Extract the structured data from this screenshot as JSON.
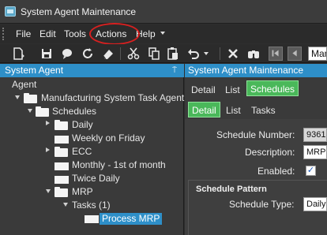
{
  "window": {
    "title": "System Agent Maintenance"
  },
  "menu": {
    "items": [
      "File",
      "Edit",
      "Tools",
      "Actions",
      "Help"
    ]
  },
  "toolbar": {
    "icons": [
      "new-icon",
      "save-icon",
      "chat-icon",
      "refresh-icon",
      "eraser-icon",
      "cut-icon",
      "copy-icon",
      "paste-icon",
      "undo-icon",
      "delete-icon",
      "binoculars-icon",
      "first-record-icon",
      "previous-record-icon"
    ],
    "search_value": "Manu"
  },
  "left_panel": {
    "header": "System Agent",
    "pin_glyph": "⍑",
    "tree": {
      "root": "Agent",
      "agent": "Manufacturing System Task Agent",
      "schedules": "Schedules",
      "items": [
        "Daily",
        "Weekly on Friday",
        "ECC",
        "Monthly - 1st of month",
        "Twice Daily",
        "MRP"
      ],
      "tasks": "Tasks (1)",
      "selected_task": "Process MRP"
    }
  },
  "right_panel": {
    "header": "System Agent Maintenance",
    "tabs_top": [
      "Detail",
      "List",
      "Schedules"
    ],
    "tabs_sub": [
      "Detail",
      "List",
      "Tasks"
    ],
    "fields": {
      "schedule_number_label": "Schedule Number:",
      "schedule_number_value": "9361",
      "description_label": "Description:",
      "description_value": "MRP",
      "enabled_label": "Enabled:",
      "enabled_checked": "✓",
      "pattern_section": "Schedule Pattern",
      "schedule_type_label": "Schedule Type:",
      "schedule_type_value": "Daily"
    }
  },
  "colors": {
    "accent_blue": "#2e8fc8",
    "active_tab_green": "#4ab85a",
    "annotation_red": "#d62020"
  }
}
